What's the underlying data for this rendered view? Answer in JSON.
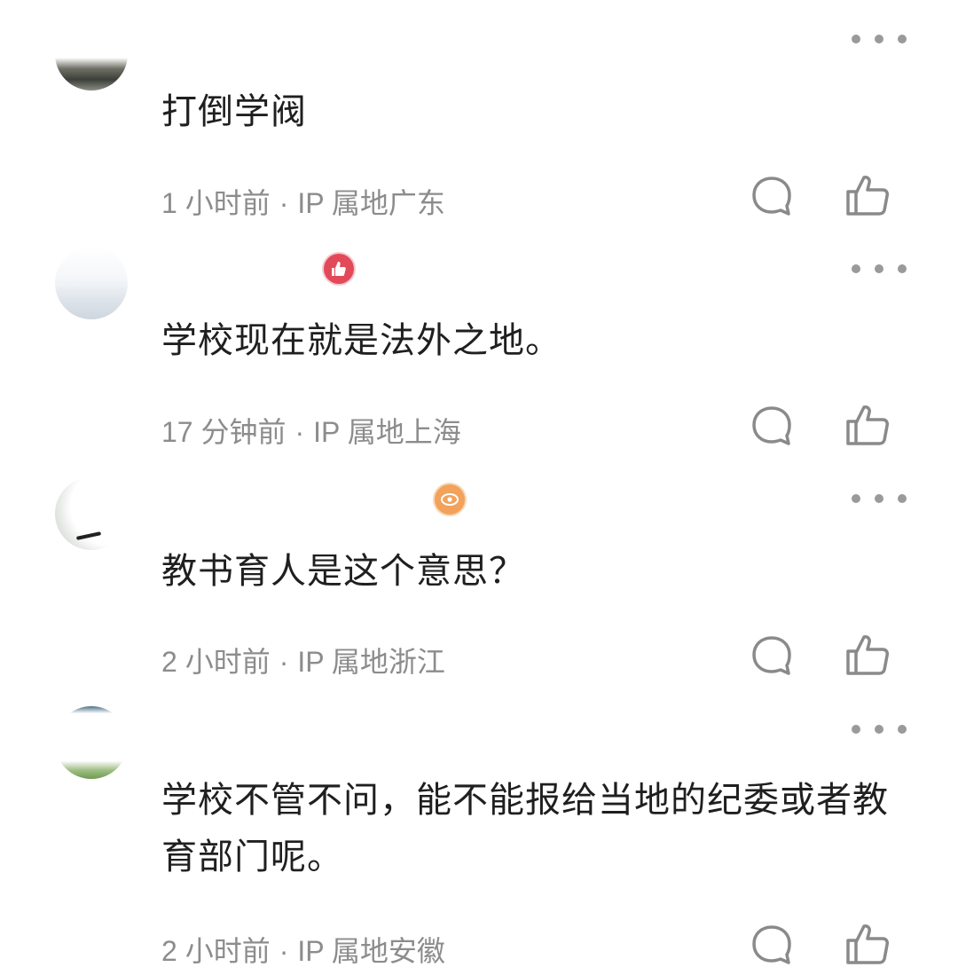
{
  "comments": [
    {
      "text": "打倒学阀",
      "time": "1 小时前",
      "separator": "·",
      "location": "IP 属地广东",
      "badge": null
    },
    {
      "text": "学校现在就是法外之地。",
      "time": "17 分钟前",
      "separator": "·",
      "location": "IP 属地上海",
      "badge": "thumbs-up-badge"
    },
    {
      "text": "教书育人是这个意思？",
      "time": "2 小时前",
      "separator": "·",
      "location": "IP 属地浙江",
      "badge": "eye-badge"
    },
    {
      "text": "学校不管不问，能不能报给当地的纪委或者教育部门呢。",
      "time": "2 小时前",
      "separator": "·",
      "location": "IP 属地安徽",
      "badge": null
    }
  ],
  "icons": {
    "more": "more-dots-icon",
    "reply": "comment-bubble-icon",
    "like": "thumbs-up-icon"
  },
  "colors": {
    "text": "#1f1f1f",
    "meta": "#8c8c8c",
    "icon": "#8a8a8a",
    "like_badge": "#e24a5a",
    "eye_badge": "#f2a25a"
  }
}
